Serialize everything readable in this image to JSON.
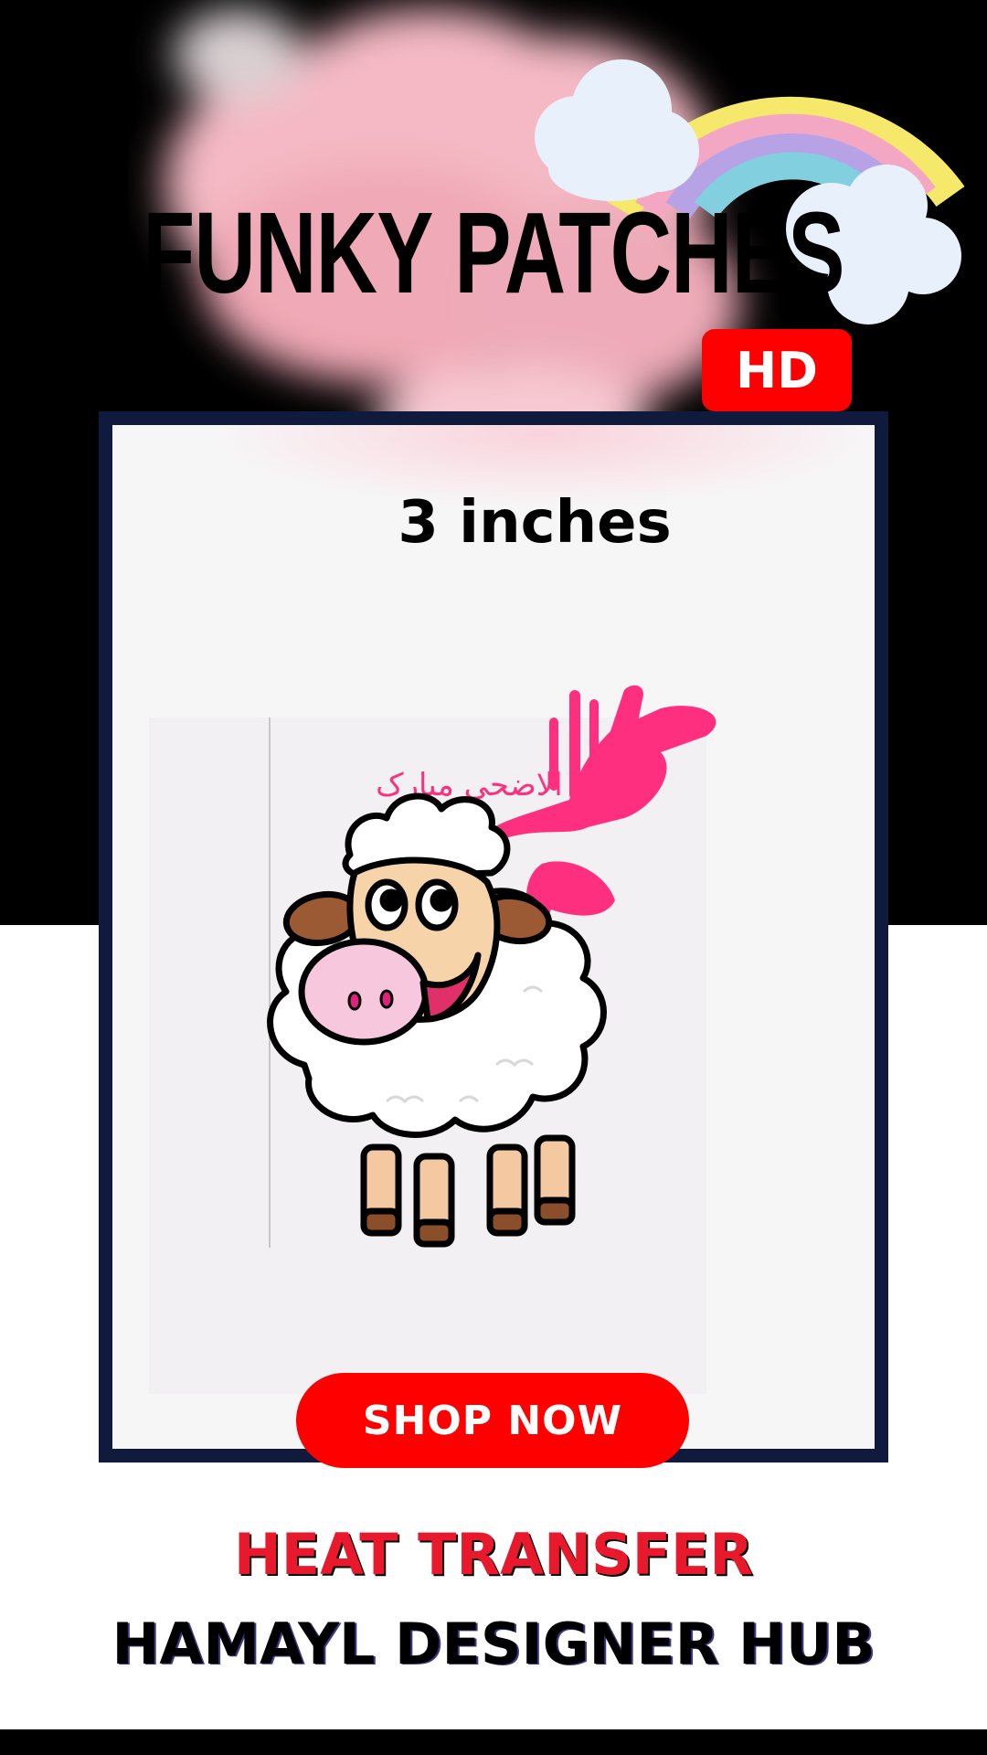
{
  "header": {
    "title": "FUNKY PATCHES",
    "badge": "HD"
  },
  "product": {
    "size_label": "3 inches",
    "artwork_text": "عید الاضحی مبارک",
    "artwork_subject": "sheep-illustration"
  },
  "cta": {
    "label": "SHOP NOW"
  },
  "footer": {
    "category": "HEAT TRANSFER",
    "brand": "HAMAYL DESIGNER HUB"
  },
  "colors": {
    "accent_red": "#ff0000",
    "category_red": "#e8192c",
    "frame_navy": "#0f1a3c",
    "artwork_pink": "#ff2f7f",
    "background_top": "#000000",
    "background_bottom": "#ffffff"
  }
}
